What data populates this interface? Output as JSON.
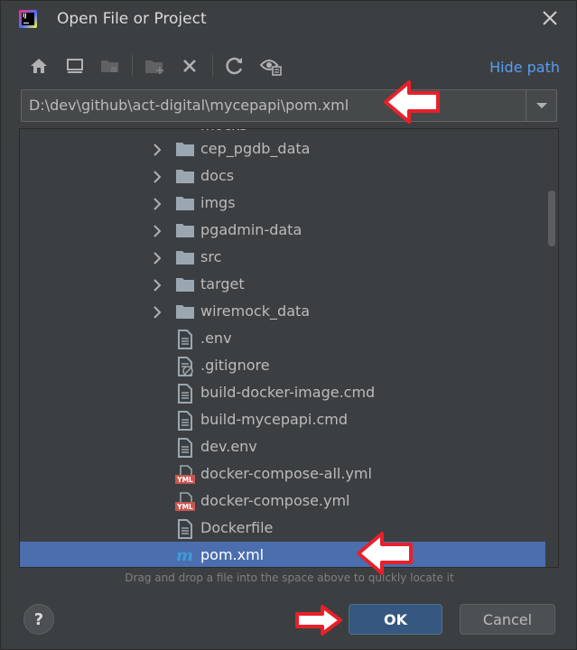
{
  "window": {
    "title": "Open File or Project",
    "app_icon_text": "IJ"
  },
  "toolbar": {
    "buttons": [
      "home-icon",
      "desktop-icon",
      "project-folder-icon",
      "new-folder-icon",
      "delete-icon",
      "refresh-icon",
      "show-hidden-icon"
    ],
    "hide_path_label": "Hide path"
  },
  "path": {
    "value": "D:\\dev\\github\\act-digital\\mycepapi\\pom.xml"
  },
  "tree": {
    "partial_item": "mocks",
    "items": [
      {
        "label": "cep_pgdb_data",
        "type": "folder"
      },
      {
        "label": "docs",
        "type": "folder"
      },
      {
        "label": "imgs",
        "type": "folder"
      },
      {
        "label": "pgadmin-data",
        "type": "folder"
      },
      {
        "label": "src",
        "type": "folder"
      },
      {
        "label": "target",
        "type": "folder"
      },
      {
        "label": "wiremock_data",
        "type": "folder"
      },
      {
        "label": ".env",
        "type": "file"
      },
      {
        "label": ".gitignore",
        "type": "ignored-file"
      },
      {
        "label": "build-docker-image.cmd",
        "type": "file"
      },
      {
        "label": "build-mycepapi.cmd",
        "type": "file"
      },
      {
        "label": "dev.env",
        "type": "file"
      },
      {
        "label": "docker-compose-all.yml",
        "type": "yml"
      },
      {
        "label": "docker-compose.yml",
        "type": "yml"
      },
      {
        "label": "Dockerfile",
        "type": "file"
      },
      {
        "label": "pom.xml",
        "type": "maven",
        "selected": true
      }
    ]
  },
  "hint": "Drag and drop a file into the space above to quickly locate it",
  "buttons": {
    "help": "?",
    "ok": "OK",
    "cancel": "Cancel"
  },
  "colors": {
    "accent": "#589df6",
    "selection": "#4b6eaf",
    "ok": "#365880",
    "annotation_arrow": "#e8202a"
  }
}
